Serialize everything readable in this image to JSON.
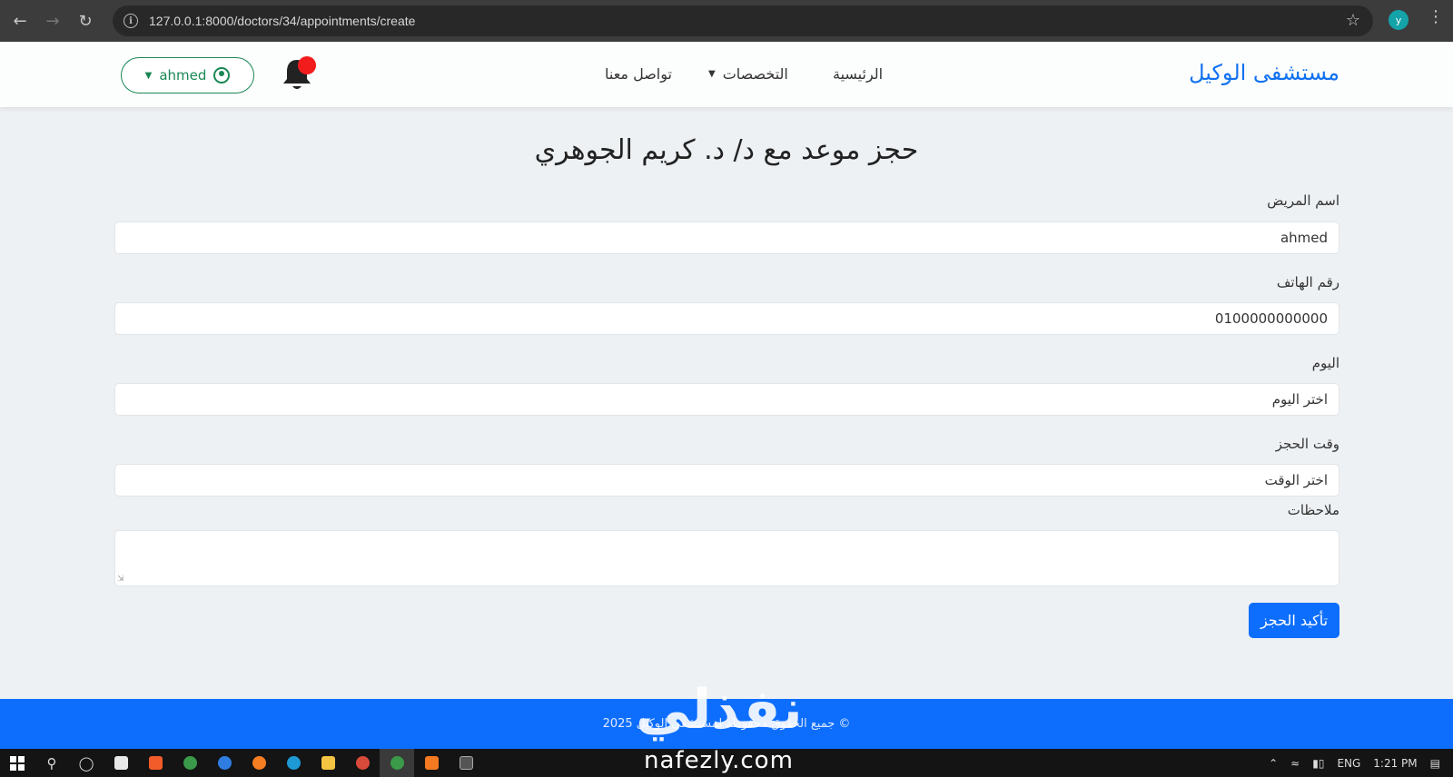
{
  "browser": {
    "url": "127.0.0.1:8000/doctors/34/appointments/create",
    "profile_initial": "y"
  },
  "navbar": {
    "brand": "مستشفى الوكيل",
    "links": {
      "home": "الرئيسية",
      "specialties": "التخصصات",
      "contact": "تواصل معنا"
    },
    "user_name": "ahmed",
    "notification_color": "#f21c1c"
  },
  "page": {
    "title": "حجز موعد مع د/ د. كريم الجوهري"
  },
  "form": {
    "patient_name_label": "اسم المريض",
    "patient_name_value": "ahmed",
    "phone_label": "رقم الهاتف",
    "phone_value": "0100000000000",
    "day_label": "اليوم",
    "day_placeholder": "اختر اليوم",
    "time_label": "وقت الحجز",
    "time_placeholder": "اختر الوقت",
    "notes_label": "ملاحظات",
    "notes_value": "",
    "submit_label": "تأكيد الحجز"
  },
  "footer": {
    "text": "© جميع الحقوق محفوظة لمستشفى الوكيل 2025"
  },
  "watermark": {
    "arabic": "نفذلي",
    "latin": "nafezly.com"
  },
  "taskbar": {
    "language": "ENG",
    "time": "1:21 PM"
  },
  "colors": {
    "brand": "#1271f0",
    "primary": "#0d6efd",
    "success": "#198754",
    "chrome": "#3c3c3c"
  }
}
